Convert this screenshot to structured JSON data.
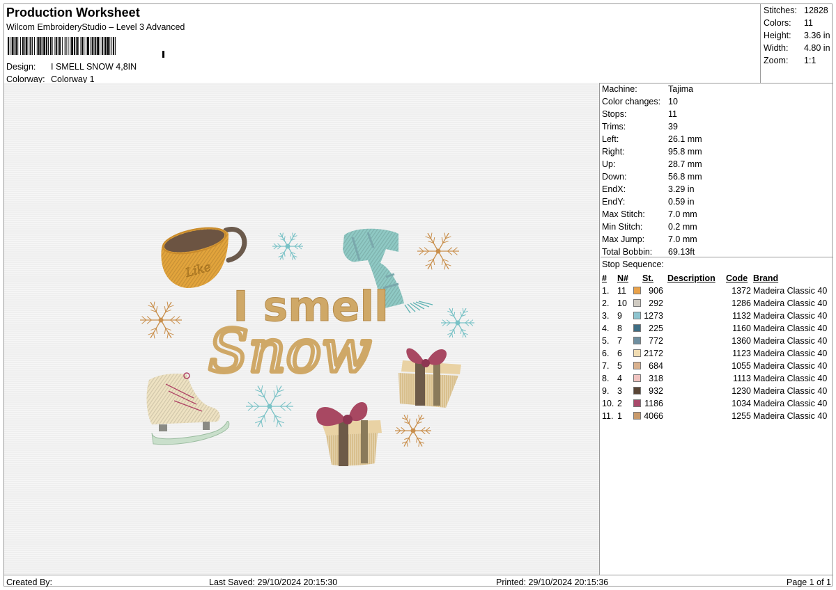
{
  "header": {
    "title": "Production Worksheet",
    "software": "Wilcom EmbroideryStudio – Level 3 Advanced",
    "design_label": "Design:",
    "design_value": "I SMELL SNOW 4,8IN",
    "colorway_label": "Colorway:",
    "colorway_value": "Colorway 1"
  },
  "summary": [
    {
      "label": "Stitches:",
      "value": "12828"
    },
    {
      "label": "Colors:",
      "value": "11"
    },
    {
      "label": "Height:",
      "value": "3.36 in"
    },
    {
      "label": "Width:",
      "value": "4.80 in"
    },
    {
      "label": "Zoom:",
      "value": "1:1"
    }
  ],
  "machine_info": [
    {
      "label": "Machine:",
      "value": "Tajima"
    },
    {
      "label": "Color changes:",
      "value": "10"
    },
    {
      "label": "Stops:",
      "value": "11"
    },
    {
      "label": "Trims:",
      "value": "39"
    },
    {
      "label": "Left:",
      "value": "26.1 mm"
    },
    {
      "label": "Right:",
      "value": "95.8 mm"
    },
    {
      "label": "Up:",
      "value": "28.7 mm"
    },
    {
      "label": "Down:",
      "value": "56.8 mm"
    },
    {
      "label": "EndX:",
      "value": "3.29 in"
    },
    {
      "label": "EndY:",
      "value": "0.59 in"
    },
    {
      "label": "Max Stitch:",
      "value": "7.0 mm"
    },
    {
      "label": "Min Stitch:",
      "value": "0.2 mm"
    },
    {
      "label": "Max Jump:",
      "value": "7.0 mm"
    },
    {
      "label": "Total Bobbin:",
      "value": "69.13ft"
    }
  ],
  "stop_sequence": {
    "title": "Stop Sequence:",
    "headers": {
      "index": "#",
      "num": "N#",
      "stitches": "St.",
      "description": "Description",
      "code": "Code",
      "brand": "Brand"
    },
    "rows": [
      {
        "index": "1.",
        "num": "11",
        "color": "#e9a24a",
        "stitches": "906",
        "description": "",
        "code": "1372",
        "brand": "Madeira Classic 40"
      },
      {
        "index": "2.",
        "num": "10",
        "color": "#cfcac1",
        "stitches": "292",
        "description": "",
        "code": "1286",
        "brand": "Madeira Classic 40"
      },
      {
        "index": "3.",
        "num": "9",
        "color": "#8ec4cf",
        "stitches": "1273",
        "description": "",
        "code": "1132",
        "brand": "Madeira Classic 40"
      },
      {
        "index": "4.",
        "num": "8",
        "color": "#3f6e84",
        "stitches": "225",
        "description": "",
        "code": "1160",
        "brand": "Madeira Classic 40"
      },
      {
        "index": "5.",
        "num": "7",
        "color": "#6f8fa0",
        "stitches": "772",
        "description": "",
        "code": "1360",
        "brand": "Madeira Classic 40"
      },
      {
        "index": "6.",
        "num": "6",
        "color": "#f0dcb2",
        "stitches": "2172",
        "description": "",
        "code": "1123",
        "brand": "Madeira Classic 40"
      },
      {
        "index": "7.",
        "num": "5",
        "color": "#d9b18e",
        "stitches": "684",
        "description": "",
        "code": "1055",
        "brand": "Madeira Classic 40"
      },
      {
        "index": "8.",
        "num": "4",
        "color": "#efc3c0",
        "stitches": "318",
        "description": "",
        "code": "1113",
        "brand": "Madeira Classic 40"
      },
      {
        "index": "9.",
        "num": "3",
        "color": "#5a4636",
        "stitches": "932",
        "description": "",
        "code": "1230",
        "brand": "Madeira Classic 40"
      },
      {
        "index": "10.",
        "num": "2",
        "color": "#a8496a",
        "stitches": "1186",
        "description": "",
        "code": "1034",
        "brand": "Madeira Classic 40"
      },
      {
        "index": "11.",
        "num": "1",
        "color": "#c99a6b",
        "stitches": "4066",
        "description": "",
        "code": "1255",
        "brand": "Madeira Classic 40"
      }
    ]
  },
  "preview": {
    "text_line1": "I smell",
    "text_line2": "Snow",
    "mug_text": "Like",
    "colors": {
      "text": "#cfa867",
      "mug": "#e2a43c",
      "scarf": "#8fc9c4",
      "gift_box": "#d9c08e",
      "bow": "#a84862",
      "skate": "#eee2c2",
      "snowflake_gold": "#c98f4c",
      "snowflake_teal": "#79c2c6"
    }
  },
  "footer": {
    "created_by": "Created By:",
    "last_saved": "Last Saved: 29/10/2024 20:15:30",
    "printed": "Printed: 29/10/2024 20:15:36",
    "page": "Page 1 of 1"
  }
}
